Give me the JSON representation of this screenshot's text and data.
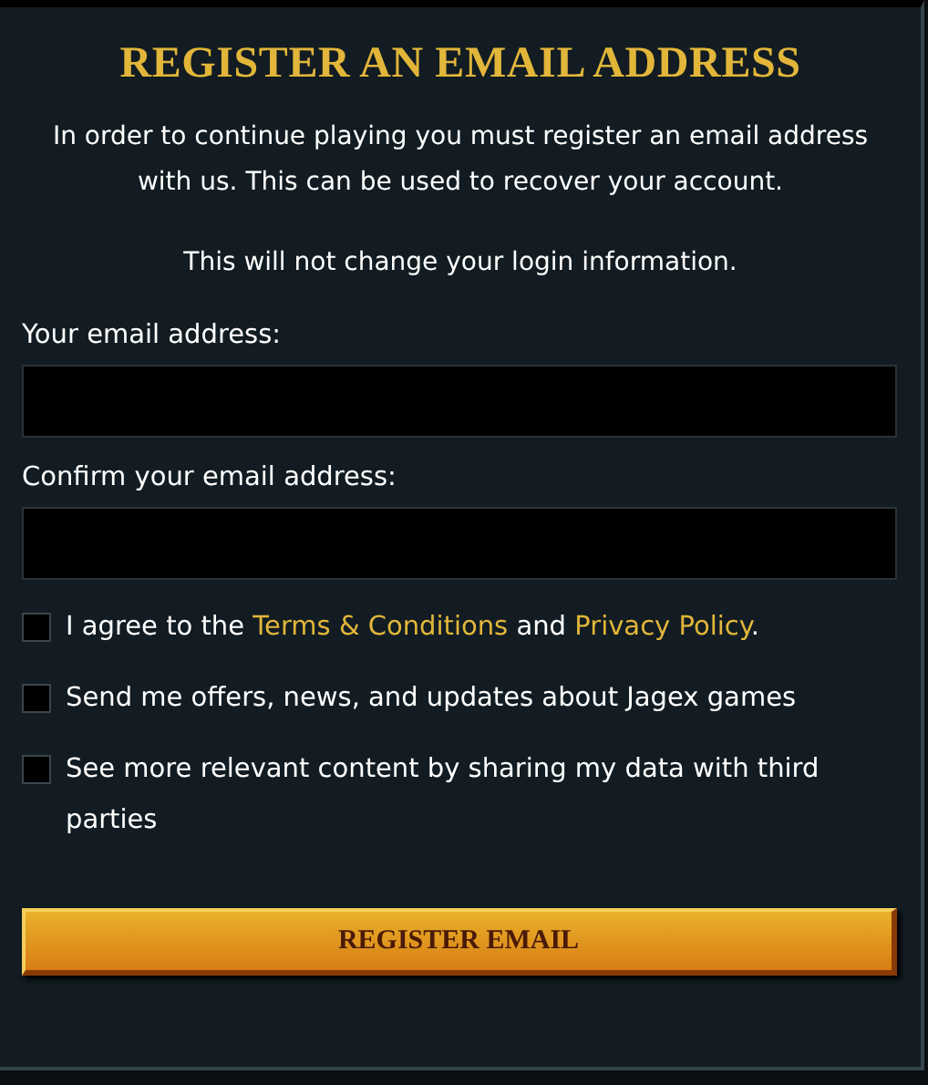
{
  "title": "REGISTER AN EMAIL ADDRESS",
  "paragraphs": [
    "In order to continue playing you must register an email address with us. This can be used to recover your account.",
    "This will not change your login information."
  ],
  "fields": [
    {
      "label": "Your email address:"
    },
    {
      "label": "Confirm your email address:"
    }
  ],
  "checkboxes": [
    {
      "checked": false,
      "parts": [
        {
          "kind": "text",
          "text": "I agree to the "
        },
        {
          "kind": "link",
          "text": "Terms & Conditions"
        },
        {
          "kind": "text",
          "text": " and "
        },
        {
          "kind": "link",
          "text": "Privacy Policy"
        },
        {
          "kind": "text",
          "text": "."
        }
      ]
    },
    {
      "checked": false,
      "parts": [
        {
          "kind": "text",
          "text": "Send me offers, news, and updates about Jagex games"
        }
      ]
    },
    {
      "checked": false,
      "parts": [
        {
          "kind": "text",
          "text": "See more relevant content by sharing my data with third parties"
        }
      ]
    }
  ],
  "button": "REGISTER EMAIL"
}
